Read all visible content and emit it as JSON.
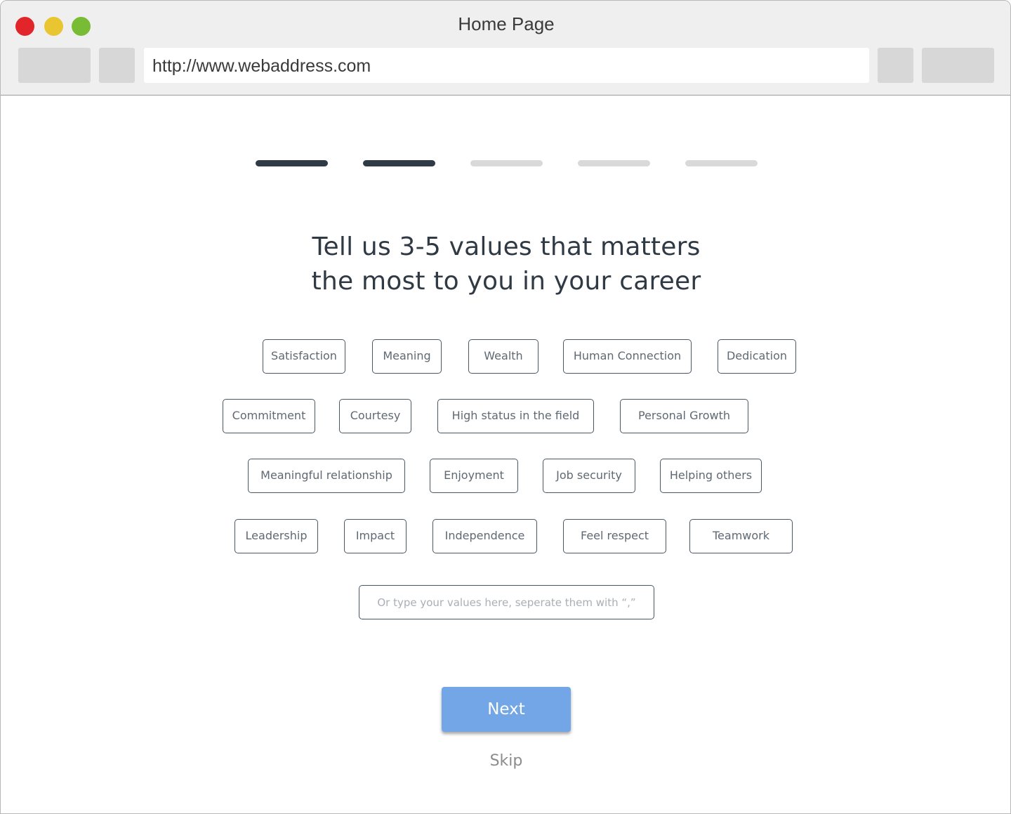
{
  "window": {
    "title": "Home Page",
    "address": "http://www.webaddress.com"
  },
  "stepper": {
    "total_steps": 5,
    "completed_steps": 2
  },
  "heading": {
    "line1": "Tell us 3-5 values that matters",
    "line2": "the most to you in your career"
  },
  "values": [
    "Satisfaction",
    "Meaning",
    "Wealth",
    "Human Connection",
    "Dedication",
    "Commitment",
    "Courtesy",
    "High status in the field",
    "Personal Growth",
    "Meaningful relationship",
    "Enjoyment",
    "Job security",
    "Helping others",
    "Leadership",
    "Impact",
    "Independence",
    "Feel respect",
    "Teamwork"
  ],
  "custom_input": {
    "placeholder": "Or type your values here, seperate them with “,”",
    "value": ""
  },
  "actions": {
    "next_label": "Next",
    "skip_label": "Skip"
  },
  "colors": {
    "accent": "#72a6e6",
    "step_active": "#2e3a46",
    "step_inactive": "#d9d9d9"
  }
}
